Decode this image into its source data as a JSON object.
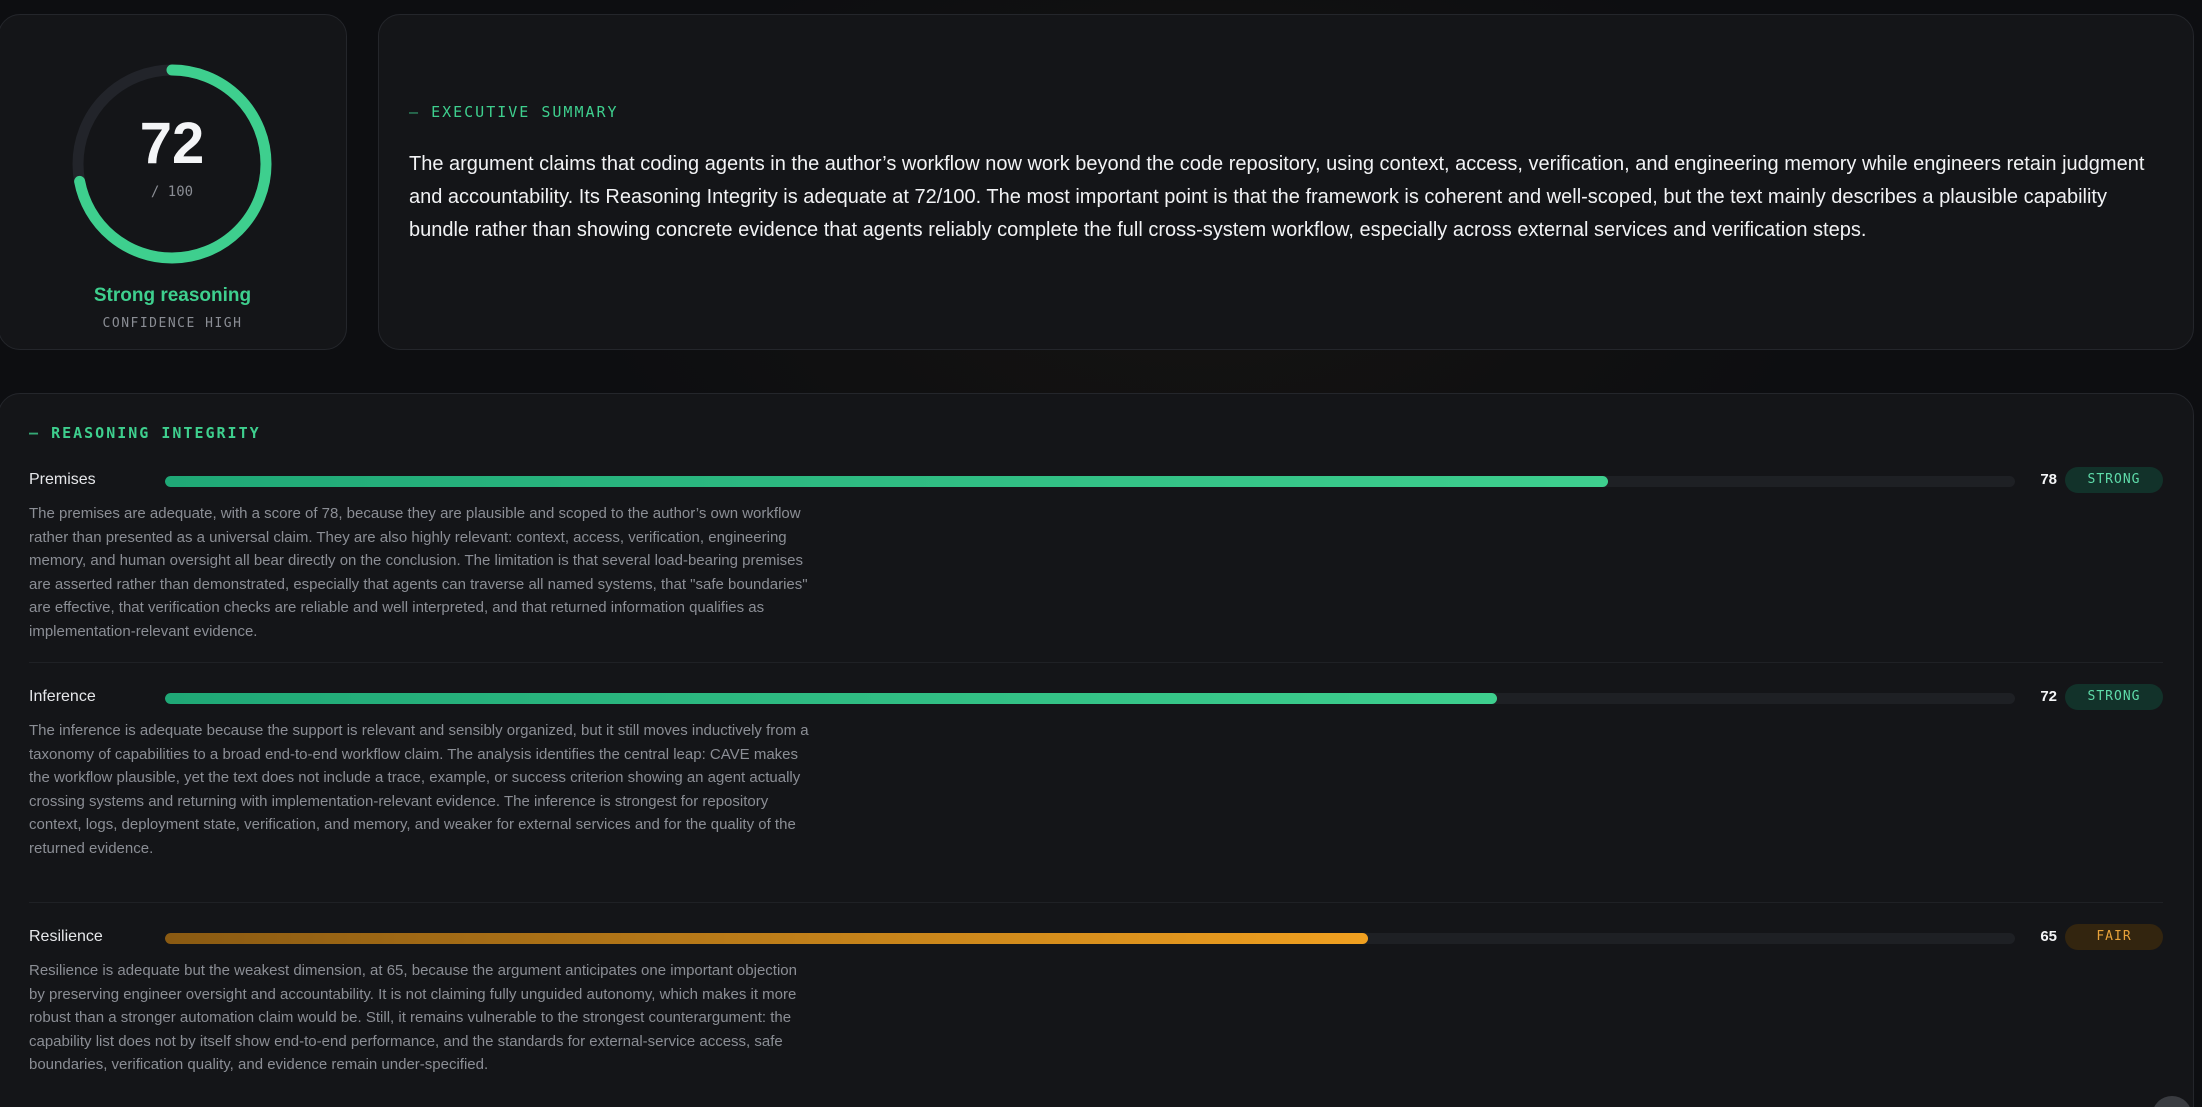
{
  "score": {
    "value": "72",
    "max": "/ 100",
    "fraction": 0.72,
    "verdict": "Strong reasoning",
    "confidence": "CONFIDENCE HIGH",
    "ring_color": "#3ecf8e"
  },
  "summary": {
    "label": "EXECUTIVE SUMMARY",
    "text": "The argument claims that coding agents in the author’s workflow now work beyond the code repository, using context, access, verification, and engineering memory while engineers retain judgment and accountability. Its Reasoning Integrity is adequate at 72/100. The most important point is that the framework is coherent and well-scoped, but the text mainly describes a plausible capability bundle rather than showing concrete evidence that agents reliably complete the full cross-system workflow, especially across external services and verification steps."
  },
  "integrity": {
    "label": "REASONING INTEGRITY",
    "dimensions": [
      {
        "name": "Premises",
        "score": "78",
        "fraction": 0.78,
        "badge": "STRONG",
        "tone": "strong",
        "description": "The premises are adequate, with a score of 78, because they are plausible and scoped to the author’s own workflow rather than presented as a universal claim. They are also highly relevant: context, access, verification, engineering memory, and human oversight all bear directly on the conclusion. The limitation is that several load-bearing premises are asserted rather than demonstrated, especially that agents can traverse all named systems, that \"safe boundaries\" are effective, that verification checks are reliable and well interpreted, and that returned information qualifies as implementation-relevant evidence."
      },
      {
        "name": "Inference",
        "score": "72",
        "fraction": 0.72,
        "badge": "STRONG",
        "tone": "strong",
        "description": "The inference is adequate because the support is relevant and sensibly organized, but it still moves inductively from a taxonomy of capabilities to a broad end-to-end workflow claim. The analysis identifies the central leap: CAVE makes the workflow plausible, yet the text does not include a trace, example, or success criterion showing an agent actually crossing systems and returning with implementation-relevant evidence. The inference is strongest for repository context, logs, deployment state, verification, and memory, and weaker for external services and for the quality of the returned evidence."
      },
      {
        "name": "Resilience",
        "score": "65",
        "fraction": 0.65,
        "badge": "FAIR",
        "tone": "fair",
        "description": "Resilience is adequate but the weakest dimension, at 65, because the argument anticipates one important objection by preserving engineer oversight and accountability. It is not claiming fully unguided autonomy, which makes it more robust than a stronger automation claim would be. Still, it remains vulnerable to the strongest counterargument: the capability list does not by itself show end-to-end performance, and the standards for external-service access, safe boundaries, verification quality, and evidence remain under-specified."
      }
    ]
  }
}
